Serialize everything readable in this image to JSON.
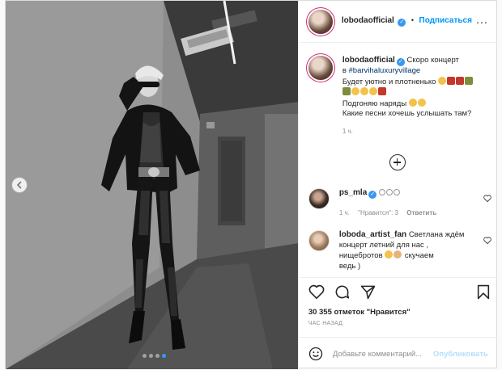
{
  "post": {
    "author": "lobodaofficial",
    "header_separator": "•",
    "follow_label": "Подписаться",
    "more_label": "...",
    "image_dots": 4,
    "active_dot": 3
  },
  "caption": {
    "author": "lobodaofficial",
    "text_1": "Скоро концерт",
    "text_2": "в ",
    "hashtag": "#barvihaluxuryvillage",
    "line_3": "Будет уютно и плотненько",
    "line_5": "Подгоняю наряды",
    "line_6": "Какие песни хочешь услышать там?",
    "time": "1 ч."
  },
  "comments": [
    {
      "author": "ps_mla",
      "text": "",
      "time": "1 ч.",
      "likes": "\"Нравится\": 3",
      "reply": "Ответить"
    },
    {
      "author": "loboda_artist_fan",
      "text_1": "Светлана ждём",
      "text_2": "концерт летний для нас ,",
      "text_3": "нищебротов",
      "text_4": "скучаем",
      "text_5": "ведь )"
    }
  ],
  "stats": {
    "likes": "30 355 отметок \"Нравится\"",
    "time_ago": "ЧАС НАЗАД"
  },
  "composer": {
    "placeholder": "Добавьте комментарий...",
    "publish_label": "Опубликовать"
  },
  "colors": {
    "accent": "#0095f6",
    "verified": "#3897f0",
    "link": "#00376b",
    "muted": "#8e8e8e",
    "publish_disabled": "#b2dffc"
  },
  "icons": [
    "chevron-left-icon",
    "more-icon",
    "verified-icon",
    "add-circle-icon",
    "heart-icon",
    "comment-icon",
    "share-icon",
    "bookmark-icon",
    "smile-icon"
  ]
}
